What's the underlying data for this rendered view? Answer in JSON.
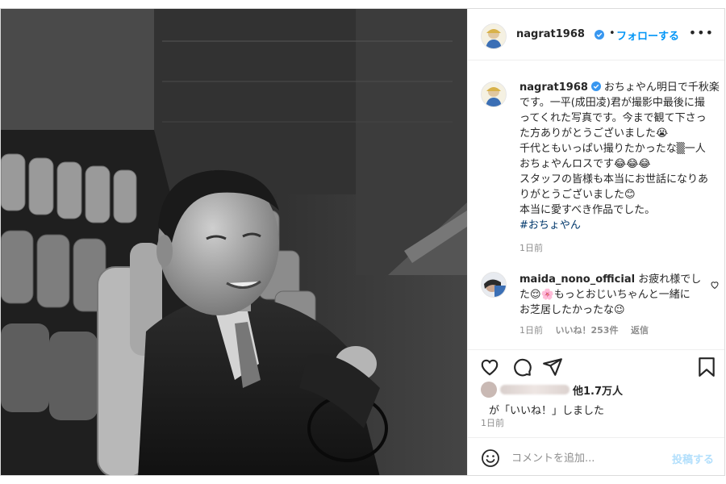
{
  "post": {
    "username": "nagrat1968",
    "follow_label": "フォローする",
    "dot": "•",
    "more_label": "•••"
  },
  "caption": {
    "username": "nagrat1968",
    "lines": [
      "おちょやん明日で千秋楽",
      "です。一平(成田凌)君が撮影中最後に撮",
      "ってくれた写真です。今まで観て下さっ",
      "た方ありがとうございました😭",
      "千代ともいっぱい撮りたかったな▒一人",
      "おちょやんロスです😂😂😂",
      "スタッフの皆様も本当にお世話になりあ",
      "りがとうございました😊",
      "本当に愛すべき作品でした。"
    ],
    "hashtag": "#おちょやん",
    "time": "1日前"
  },
  "comment": {
    "username": "maida_nono_official",
    "line1": "お疲れ様でし",
    "line2": "た😌🌸もっとおじいちゃんと一緒に",
    "line3": "お芝居したかったな😉",
    "time": "1日前",
    "likes": "いいね！253件",
    "reply": "返信"
  },
  "likes": {
    "count_label": "他1.7万人",
    "liked_text": "が「いいね！」しました"
  },
  "post_time": "1日前",
  "comment_bar": {
    "placeholder": "コメントを追加...",
    "post_label": "投稿する"
  },
  "colors": {
    "accent": "#0095f6",
    "post_button_disabled": "#b2dffc",
    "verified": "#3897f0",
    "text": "#262626",
    "muted": "#8e8e8e",
    "hashtag": "#00376b"
  }
}
